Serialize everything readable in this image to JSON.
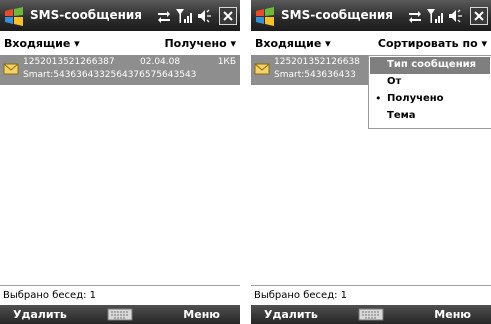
{
  "left": {
    "title": "SMS-сообщения",
    "folder": "Входящие",
    "sort_label": "Получено",
    "message": {
      "number": "1252013521266387",
      "date": "02.04.08",
      "size": "1КБ",
      "sender": "Smart:5436364332564376575643543"
    },
    "status": "Выбрано бесед: 1",
    "softkey_left": "Удалить",
    "softkey_right": "Меню"
  },
  "right": {
    "title": "SMS-сообщения",
    "folder": "Входящие",
    "sort_label": "Сортировать по",
    "message": {
      "number": "125201352126638",
      "sender": "Smart:543636433"
    },
    "menu": {
      "items": [
        {
          "label": "Тип сообщения"
        },
        {
          "label": "От"
        },
        {
          "label": "Получено"
        },
        {
          "label": "Тема"
        }
      ],
      "selected_index": 0,
      "checked_index": 2
    },
    "status": "Выбрано бесед: 1",
    "softkey_left": "Удалить",
    "softkey_right": "Меню"
  },
  "icons": {
    "start": "windows-logo-icon",
    "connectivity": "arrows-icon",
    "signal": "signal-icon",
    "volume": "speaker-icon",
    "close": "close-icon",
    "message": "envelope-icon",
    "keyboard": "keyboard-icon"
  }
}
